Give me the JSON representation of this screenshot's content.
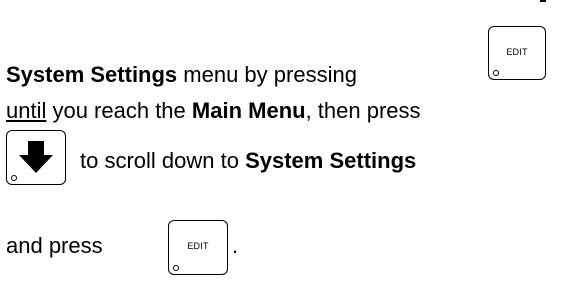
{
  "instruction": {
    "line1_bold": "System Settings",
    "line1_text": " menu by pressing",
    "line2_underlined": "until",
    "line2_text_a": " you reach the ",
    "line2_bold": "Main Menu",
    "line2_text_b": ", then press",
    "line3_text": "to scroll down to ",
    "line3_bold": "System Settings",
    "line4_text": "and press",
    "line4_period": "."
  },
  "keys": {
    "edit_key_label": "EDIT",
    "down_arrow_icon": "down-arrow-icon"
  }
}
